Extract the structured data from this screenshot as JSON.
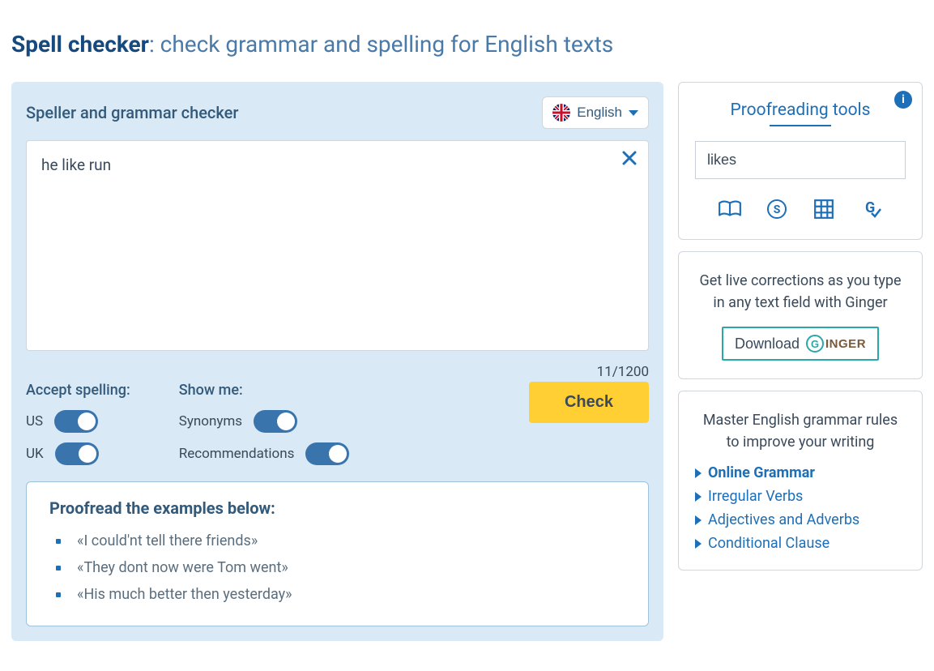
{
  "title": {
    "bold": "Spell checker",
    "rest": ": check grammar and spelling for English texts"
  },
  "checker": {
    "heading": "Speller and grammar checker",
    "language_label": "English",
    "input_text": "he like run",
    "counter": "11/1200",
    "accept_label": "Accept spelling:",
    "us_label": "US",
    "uk_label": "UK",
    "showme_label": "Show me:",
    "synonyms_label": "Synonyms",
    "recommend_label": "Recommendations",
    "check_button": "Check"
  },
  "examples": {
    "title": "Proofread the examples below:",
    "items": [
      "«I could'nt tell there friends»",
      "«They dont now were Tom went»",
      "«His much better then yesterday»"
    ]
  },
  "proof_tools": {
    "title": "Proofreading tools",
    "search_value": "likes"
  },
  "ginger_card": {
    "text": "Get live corrections as you type in any text field with Ginger",
    "download_label": "Download",
    "brand": "INGER"
  },
  "grammar_card": {
    "text": "Master English grammar rules to improve your writing",
    "links": [
      "Online Grammar",
      "Irregular Verbs",
      "Adjectives and Adverbs",
      "Conditional Clause"
    ]
  }
}
